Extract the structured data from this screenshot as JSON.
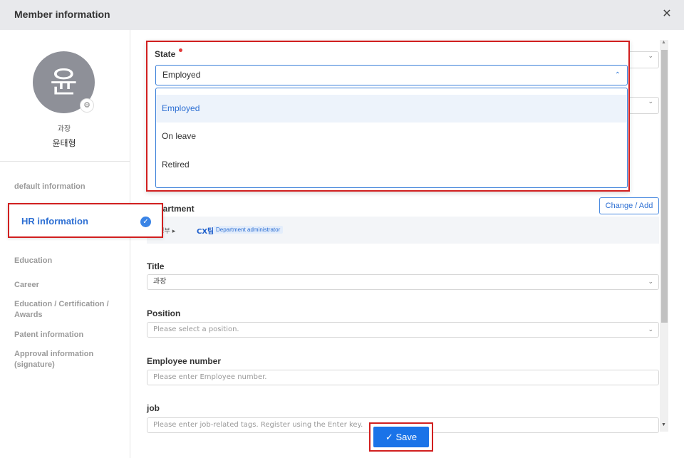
{
  "header": {
    "title": "Member information",
    "close_icon": "close-icon"
  },
  "profile": {
    "avatar_text": "윤",
    "rank": "과장",
    "name": "윤태형",
    "settings_icon": "gear-icon"
  },
  "sidebar": {
    "items": [
      {
        "label": "default information"
      },
      {
        "label": "HR information",
        "active": true
      },
      {
        "label": "Education"
      },
      {
        "label": "Career"
      },
      {
        "label": "Education / Certification / Awards"
      },
      {
        "label": "Patent information"
      },
      {
        "label": "Approval information (signature)"
      }
    ]
  },
  "state": {
    "label": "State",
    "selected": "Employed",
    "options": [
      "Employed",
      "On leave",
      "Retired"
    ]
  },
  "department": {
    "label": "Department",
    "change_button": "Change / Add",
    "path": "경영부 ▸",
    "team": "CX팀",
    "badge": "Department administrator"
  },
  "title_field": {
    "label": "Title",
    "value": "과장"
  },
  "position_field": {
    "label": "Position",
    "placeholder": "Please select a position."
  },
  "employee_number": {
    "label": "Employee number",
    "placeholder": "Please enter Employee number."
  },
  "job": {
    "label": "job",
    "placeholder": "Please enter job-related tags. Register using the Enter key."
  },
  "save_button": {
    "label": "Save",
    "icon": "check-icon"
  },
  "colors": {
    "accent": "#1a73e8",
    "highlight_border": "#d11f1f",
    "link": "#2d6fd3"
  }
}
